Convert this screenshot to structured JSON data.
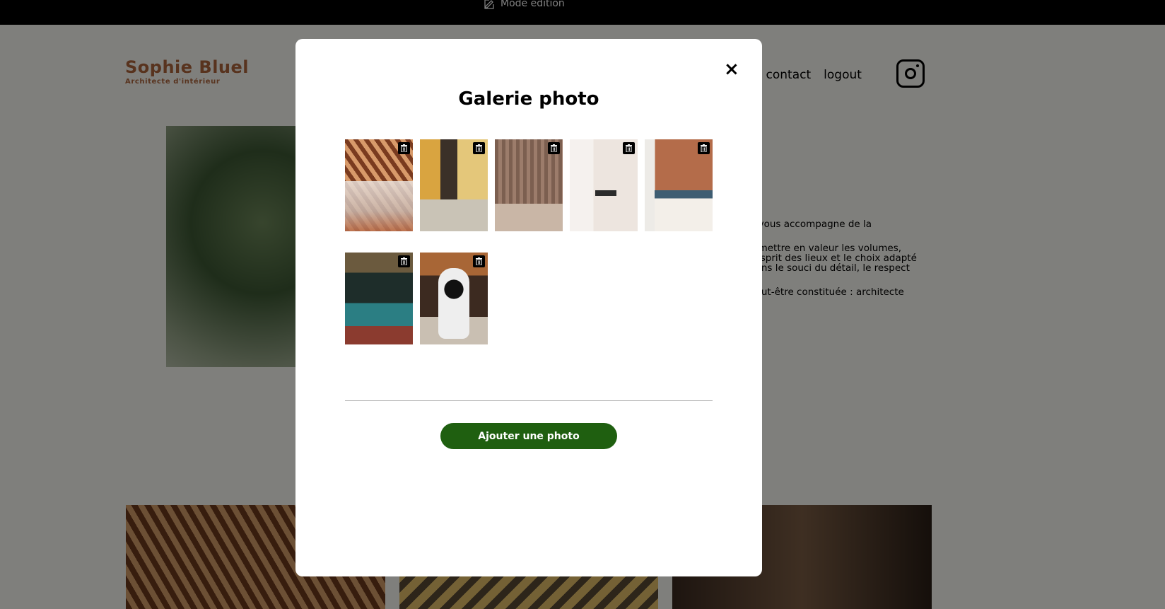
{
  "edit_bar": {
    "label": "Mode édition",
    "icon": "edit-icon"
  },
  "header": {
    "logo_title": "Sophie Bluel",
    "logo_subtitle": "Architecte d'intérieur",
    "nav": [
      "ts",
      "contact",
      "logout"
    ],
    "instagram_icon": "instagram-icon"
  },
  "intro": {
    "paragraphs": [
      "e vous accompagne de la",
      "à mettre en valeur les volumes,\nl'esprit des lieux et le choix adapté\ndans le souci du détail, le respect",
      "peut-être constituée : architecte"
    ]
  },
  "modal": {
    "close_label": "×",
    "title": "Galerie photo",
    "photos": [
      {
        "alt": "restaurant",
        "icon": "trash-icon"
      },
      {
        "alt": "living room",
        "icon": "trash-icon"
      },
      {
        "alt": "kitchen",
        "icon": "trash-icon"
      },
      {
        "alt": "minimal room",
        "icon": "trash-icon"
      },
      {
        "alt": "bedroom",
        "icon": "trash-icon"
      },
      {
        "alt": "bar",
        "icon": "trash-icon"
      },
      {
        "alt": "dog",
        "icon": "trash-icon"
      }
    ],
    "add_button": "Ajouter une photo"
  },
  "colors": {
    "brand": "#B1663C",
    "button": "#1F5F10",
    "overlay": "rgba(0,0,0,0.5)"
  }
}
